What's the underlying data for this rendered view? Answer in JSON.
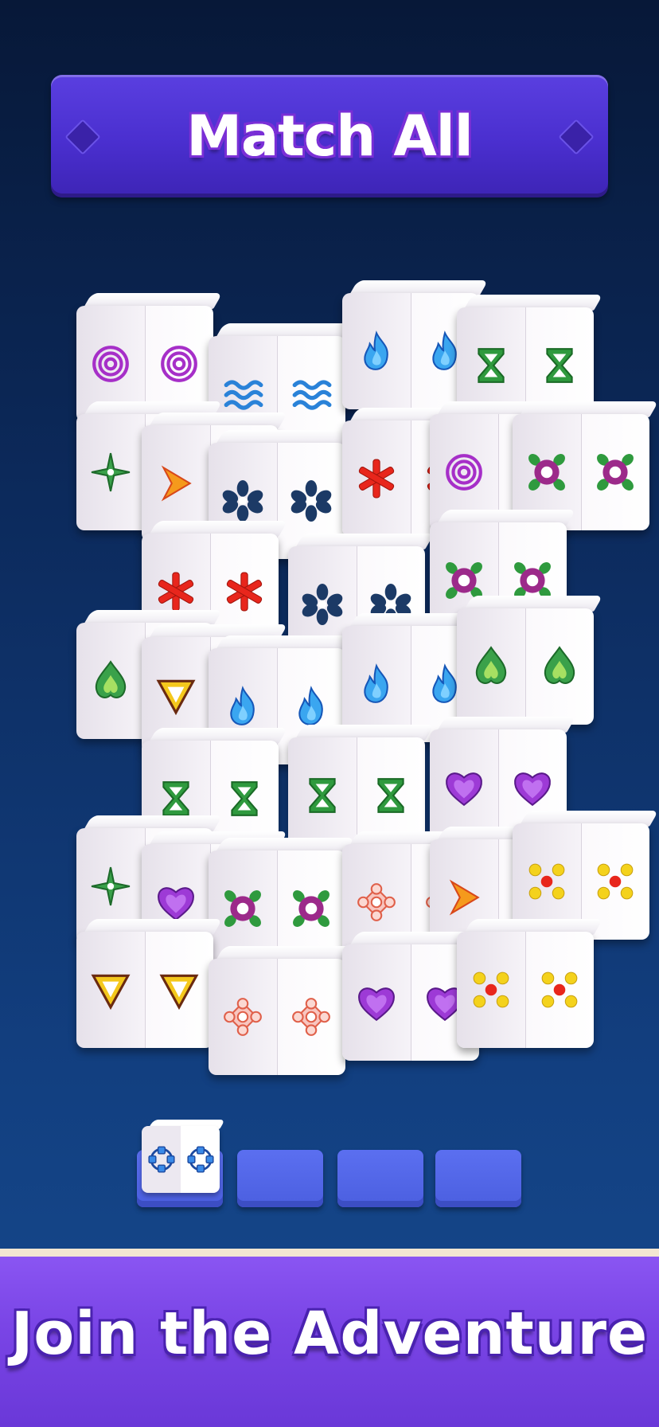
{
  "title": "Match All",
  "footer": {
    "cta": "Join the Adventure"
  },
  "colors": {
    "banner": "#4a2fcf",
    "footer": "#7a45e6",
    "tray_slot": "#5b6ff0",
    "background_top": "#071838",
    "background_bottom": "#164a8e"
  },
  "board": {
    "tiles": [
      {
        "symbol": "target-icon"
      },
      {
        "symbol": "waves-icon"
      },
      {
        "symbol": "blue-flame-icon"
      },
      {
        "symbol": "hourglass-icon"
      },
      {
        "symbol": "green-star-icon"
      },
      {
        "symbol": "orange-chevron-icon"
      },
      {
        "symbol": "navy-flower-icon"
      },
      {
        "symbol": "red-asterisk-icon"
      },
      {
        "symbol": "target-icon"
      },
      {
        "symbol": "green-purple-flower-icon"
      },
      {
        "symbol": "red-asterisk-icon"
      },
      {
        "symbol": "navy-flower-icon"
      },
      {
        "symbol": "green-purple-flower-icon"
      },
      {
        "symbol": "green-heart-icon"
      },
      {
        "symbol": "triangle-icon"
      },
      {
        "symbol": "blue-flame-icon"
      },
      {
        "symbol": "blue-flame-icon"
      },
      {
        "symbol": "green-heart-icon"
      },
      {
        "symbol": "hourglass-icon"
      },
      {
        "symbol": "hourglass-icon"
      },
      {
        "symbol": "purple-heart-icon"
      },
      {
        "symbol": "green-star-icon"
      },
      {
        "symbol": "purple-heart-icon"
      },
      {
        "symbol": "green-purple-flower-icon"
      },
      {
        "symbol": "pink-flower-icon"
      },
      {
        "symbol": "orange-chevron-icon"
      },
      {
        "symbol": "dice-dots-icon"
      },
      {
        "symbol": "triangle-icon"
      },
      {
        "symbol": "pink-flower-icon"
      },
      {
        "symbol": "purple-heart-icon"
      },
      {
        "symbol": "dice-dots-icon"
      }
    ]
  },
  "tray": {
    "slot_count": 4,
    "filled": [
      {
        "symbol": "blue-ring-icon"
      }
    ]
  }
}
